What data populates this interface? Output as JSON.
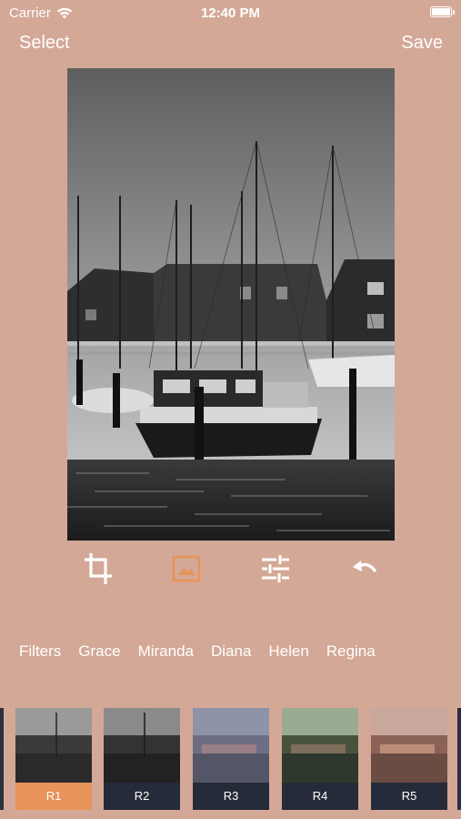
{
  "status": {
    "carrier": "Carrier",
    "time": "12:40 PM"
  },
  "nav": {
    "select_label": "Select",
    "save_label": "Save"
  },
  "toolbar": {
    "icons": [
      "crop-icon",
      "image-icon",
      "tune-icon",
      "undo-icon"
    ],
    "active": "image-icon",
    "active_color": "#e8935a"
  },
  "filter_tabs": [
    "Filters",
    "Grace",
    "Miranda",
    "Diana",
    "Helen",
    "Regina"
  ],
  "thumbnails": [
    {
      "label": "R1",
      "selected": true
    },
    {
      "label": "R2",
      "selected": false
    },
    {
      "label": "R3",
      "selected": false
    },
    {
      "label": "R4",
      "selected": false
    },
    {
      "label": "R5",
      "selected": false
    }
  ],
  "colors": {
    "background": "#d4a896",
    "accent": "#e8935a",
    "label_bg": "#252b38"
  }
}
